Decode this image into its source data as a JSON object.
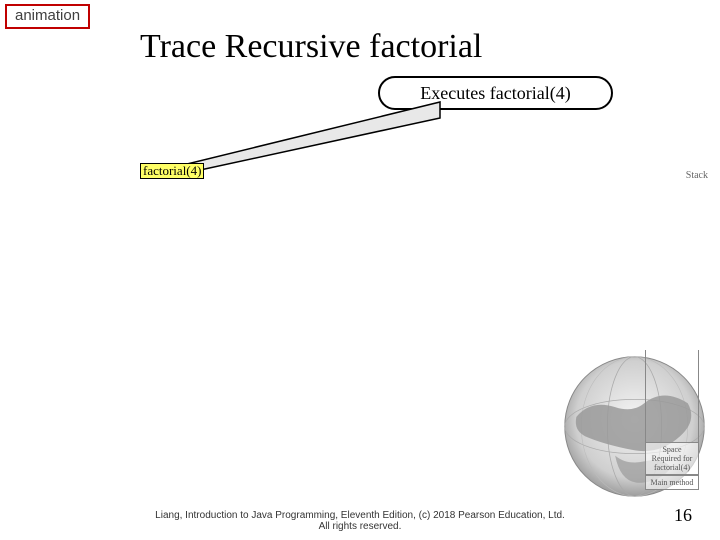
{
  "badge": {
    "label": "animation"
  },
  "title": "Trace Recursive factorial",
  "callout": {
    "text": "Executes factorial(4)"
  },
  "code_label": "factorial(4)",
  "stack": {
    "heading": "Stack",
    "cells": [
      "Space Required for factorial(4)",
      "Main method"
    ]
  },
  "footer": {
    "line1": "Liang, Introduction to Java Programming, Eleventh Edition, (c) 2018 Pearson Education, Ltd.",
    "line2": "All rights reserved."
  },
  "page_number": "16"
}
